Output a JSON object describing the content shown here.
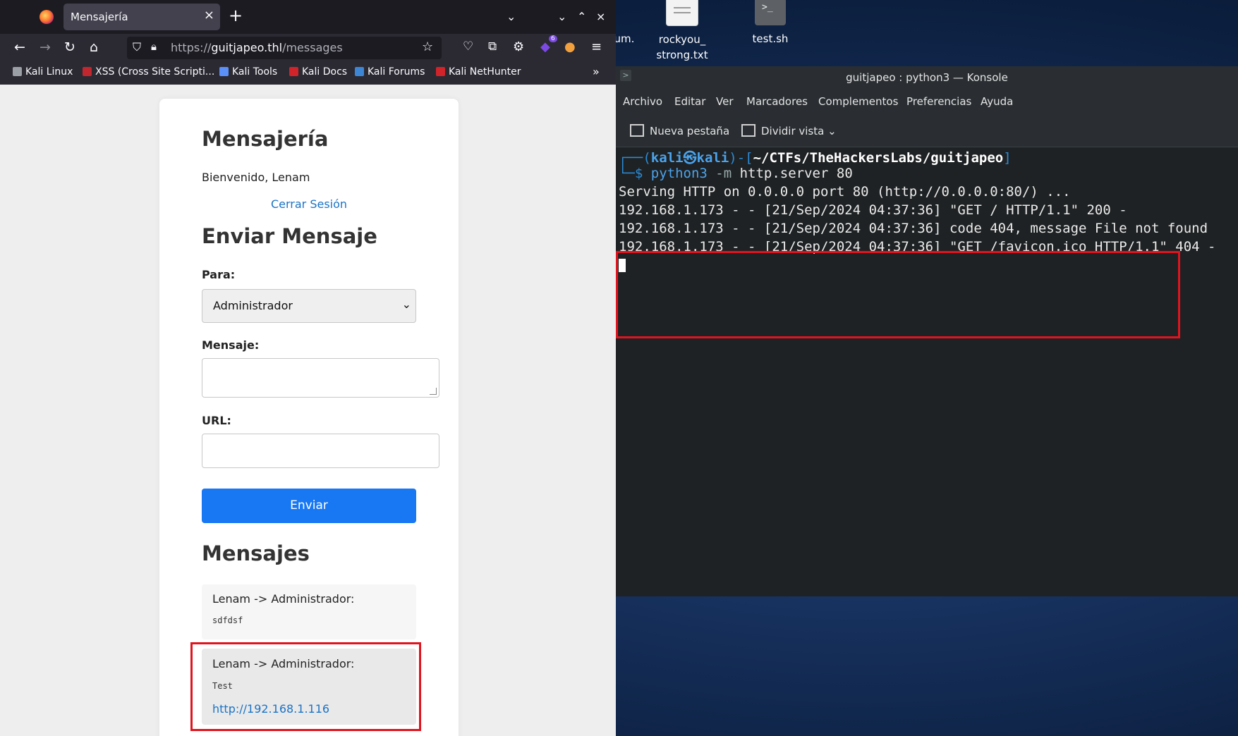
{
  "desktop": {
    "icons": [
      {
        "label": "um.",
        "icon": "file-icon"
      },
      {
        "label": "rockyou_ strong.txt",
        "icon": "text-file-icon"
      },
      {
        "label": "test.sh",
        "icon": "terminal-script-icon"
      }
    ]
  },
  "browser": {
    "tab_title": "Mensajería",
    "url": {
      "scheme": "https://",
      "host": "guitjapeo.thl",
      "path": "/messages"
    },
    "bookmarks": [
      {
        "label": "Kali Linux",
        "color": "#9aa0a6"
      },
      {
        "label": "XSS (Cross Site Scripti...",
        "color": "#c2262e"
      },
      {
        "label": "Kali Tools",
        "color": "#5b8ff9"
      },
      {
        "label": "Kali Docs",
        "color": "#d1232a"
      },
      {
        "label": "Kali Forums",
        "color": "#3d86d6"
      },
      {
        "label": "Kali NetHunter",
        "color": "#d1232a"
      }
    ],
    "extension_badge": "6"
  },
  "page": {
    "title": "Mensajería",
    "welcome": "Bienvenido, Lenam",
    "logout": "Cerrar Sesión",
    "send_title": "Enviar Mensaje",
    "to_label": "Para:",
    "to_value": "Administrador",
    "message_label": "Mensaje:",
    "url_label": "URL:",
    "send_button": "Enviar",
    "messages_title": "Mensajes",
    "messages": [
      {
        "header": "Lenam -> Administrador:",
        "body": "sdfdsf",
        "link": ""
      },
      {
        "header": "Lenam -> Administrador:",
        "body": "Test",
        "link": "http://192.168.1.116"
      }
    ],
    "accent_color": "#1877f2"
  },
  "konsole": {
    "title": "guitjapeo : python3 — Konsole",
    "menu": [
      "Archivo",
      "Editar",
      "Ver",
      "Marcadores",
      "Complementos",
      "Preferencias",
      "Ayuda"
    ],
    "toolbar": {
      "new_tab": "Nueva pestaña",
      "split_view": "Dividir vista"
    },
    "prompt": {
      "prefix": "┌──(",
      "user": "kali㉿kali",
      "mid": ")-[",
      "cwd": "~/CTFs/TheHackersLabs/guitjapeo",
      "suffix": "]",
      "line2": "└─$ ",
      "command_name": "python3",
      "command_flag": " -m",
      "command_args": " http.server 80"
    },
    "output": [
      "Serving HTTP on 0.0.0.0 port 80 (http://0.0.0.0:80/) ...",
      "192.168.1.173 - - [21/Sep/2024 04:37:36] \"GET / HTTP/1.1\" 200 -",
      "192.168.1.173 - - [21/Sep/2024 04:37:36] code 404, message File not found",
      "192.168.1.173 - - [21/Sep/2024 04:37:36] \"GET /favicon.ico HTTP/1.1\" 404 -"
    ]
  }
}
